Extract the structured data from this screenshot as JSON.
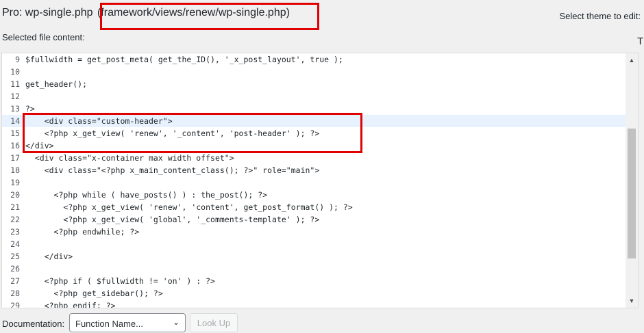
{
  "header": {
    "title_prefix": "Pro: wp-single.php",
    "title_path": "(framework/views/renew/wp-single.php)",
    "theme_label": "Select theme to edit:",
    "theme_cut": "T"
  },
  "editor_label": "Selected file content:",
  "code": {
    "lines": [
      {
        "n": "9",
        "text": "$fullwidth = get_post_meta( get_the_ID(), '_x_post_layout', true );"
      },
      {
        "n": "10",
        "text": ""
      },
      {
        "n": "11",
        "text": "get_header();"
      },
      {
        "n": "12",
        "text": ""
      },
      {
        "n": "13",
        "text": "?>"
      },
      {
        "n": "14",
        "text": "    <div class=\"custom-header\">"
      },
      {
        "n": "15",
        "text": "    <?php x_get_view( 'renew', '_content', 'post-header' ); ?>"
      },
      {
        "n": "16",
        "text": "</div>"
      },
      {
        "n": "17",
        "text": "  <div class=\"x-container max width offset\">"
      },
      {
        "n": "18",
        "text": "    <div class=\"<?php x_main_content_class(); ?>\" role=\"main\">"
      },
      {
        "n": "19",
        "text": ""
      },
      {
        "n": "20",
        "text": "      <?php while ( have_posts() ) : the_post(); ?>"
      },
      {
        "n": "21",
        "text": "        <?php x_get_view( 'renew', 'content', get_post_format() ); ?>"
      },
      {
        "n": "22",
        "text": "        <?php x_get_view( 'global', '_comments-template' ); ?>"
      },
      {
        "n": "23",
        "text": "      <?php endwhile; ?>"
      },
      {
        "n": "24",
        "text": ""
      },
      {
        "n": "25",
        "text": "    </div>"
      },
      {
        "n": "26",
        "text": ""
      },
      {
        "n": "27",
        "text": "    <?php if ( $fullwidth != 'on' ) : ?>"
      },
      {
        "n": "28",
        "text": "      <?php get_sidebar(); ?>"
      },
      {
        "n": "29",
        "text": "    <?php endif; ?>"
      }
    ]
  },
  "footer": {
    "doc_label": "Documentation:",
    "select_value": "Function Name...",
    "lookup_label": "Look Up"
  },
  "colors": {
    "highlight_border": "#e00000",
    "active_line": "#e8f2ff"
  }
}
